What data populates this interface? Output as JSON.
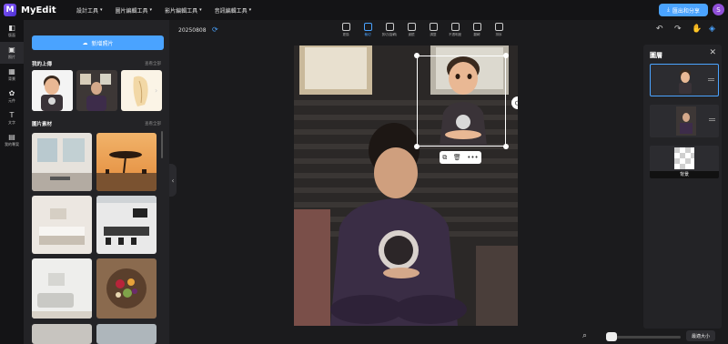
{
  "app": {
    "logo_letter": "M",
    "name": "MyEdit"
  },
  "topnav": [
    {
      "label": "設計工具"
    },
    {
      "label": "圖片編輯工具"
    },
    {
      "label": "影片編輯工具"
    },
    {
      "label": "音訊編輯工具"
    }
  ],
  "header": {
    "export_label": "匯出和分享",
    "avatar_letter": "S"
  },
  "leftrail": [
    {
      "icon": "◧",
      "label": "版面"
    },
    {
      "icon": "▣",
      "label": "照片"
    },
    {
      "icon": "▦",
      "label": "背景"
    },
    {
      "icon": "✿",
      "label": "元件"
    },
    {
      "icon": "T",
      "label": "文字"
    },
    {
      "icon": "▤",
      "label": "我的專案"
    }
  ],
  "panel": {
    "upload_label": "新增照片",
    "my_uploads_title": "我的上傳",
    "my_uploads_see_all": "查看全部",
    "stock_title": "圖片素材",
    "stock_see_all": "查看全部"
  },
  "toolbar": {
    "doc_name": "20250808",
    "tools": [
      {
        "label": "更換"
      },
      {
        "label": "裁切"
      },
      {
        "label": "剪切(旋轉)"
      },
      {
        "label": "濾鏡"
      },
      {
        "label": "調整"
      },
      {
        "label": "不透明度"
      },
      {
        "label": "翻轉"
      },
      {
        "label": "排序"
      }
    ]
  },
  "layers_panel": {
    "title": "圖層",
    "background_label": "背景"
  },
  "icons": {
    "close": "✕",
    "undo": "↶",
    "redo": "↷",
    "hand": "✋",
    "layers": "◈",
    "zoom": "⌕",
    "sync": "⟳",
    "collapse": "‹",
    "export": "⤓"
  },
  "zoom": {
    "fit_label": "最適大小"
  },
  "colors": {
    "accent": "#4aa3ff",
    "brand": "#6a3fe0",
    "avatar": "#8f4fd8"
  }
}
